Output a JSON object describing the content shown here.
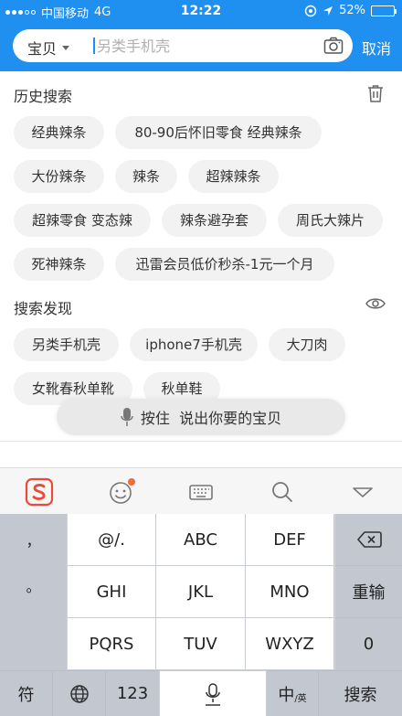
{
  "status_bar": {
    "carrier": "中国移动",
    "network": "4G",
    "time": "12:22",
    "battery": "52%",
    "battery_level": 0.52
  },
  "search": {
    "scope_label": "宝贝",
    "placeholder": "另类手机壳",
    "cancel_label": "取消"
  },
  "history": {
    "title": "历史搜索",
    "items": [
      "经典辣条",
      "80-90后怀旧零食 经典辣条",
      "大份辣条",
      "辣条",
      "超辣辣条",
      "超辣零食 变态辣",
      "辣条避孕套",
      "周氏大辣片",
      "死神辣条",
      "迅雷会员低价秒杀-1元一个月"
    ]
  },
  "discover": {
    "title": "搜索发现",
    "items": [
      "另类手机壳",
      "iphone7手机壳",
      "大刀肉",
      "女靴春秋单靴",
      "秋单鞋"
    ]
  },
  "voice": {
    "label": "按住  说出你要的宝贝"
  },
  "keyboard": {
    "punctuation": [
      "，",
      "。",
      "？",
      "！"
    ],
    "keys": [
      "@/.",
      "ABC",
      "DEF",
      "GHI",
      "JKL",
      "MNO",
      "PQRS",
      "TUV",
      "WXYZ"
    ],
    "reinput_label": "重输",
    "zero_label": "0",
    "symbol_label": "符",
    "number_label": "123",
    "lang_main": "中",
    "lang_sub": "/英",
    "search_label": "搜索"
  }
}
